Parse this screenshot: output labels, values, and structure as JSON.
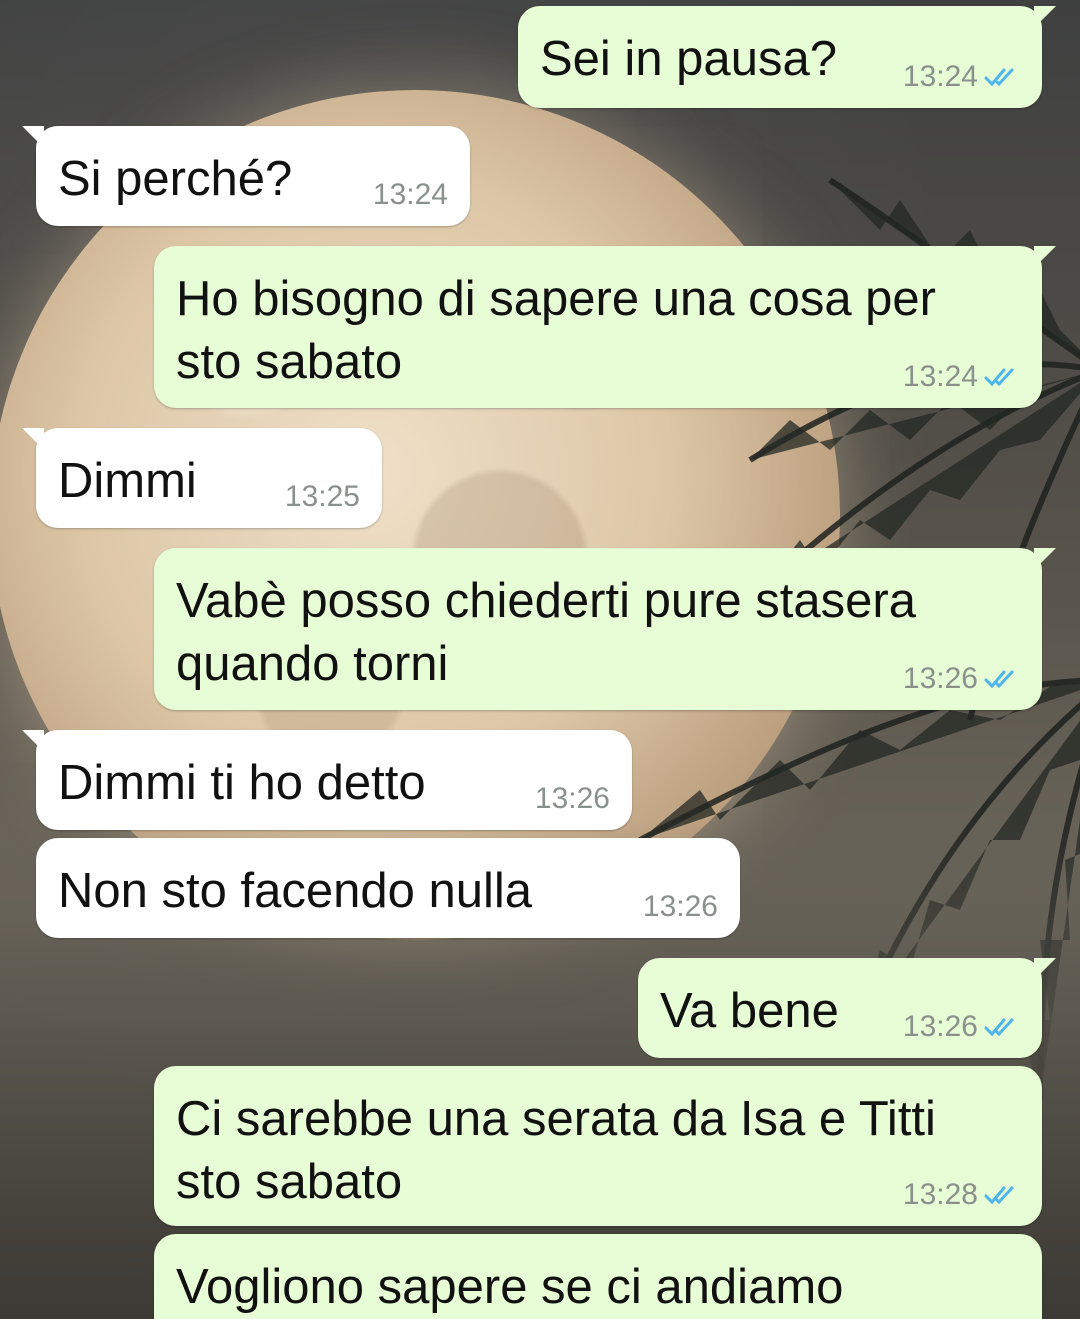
{
  "conversation": {
    "messages": [
      {
        "direction": "out",
        "text": "Sei in pausa?",
        "time": "13:24",
        "status": "read"
      },
      {
        "direction": "in",
        "text": "Si perché?",
        "time": "13:24"
      },
      {
        "direction": "out",
        "text": "Ho bisogno di sapere una cosa per sto sabato",
        "time": "13:24",
        "status": "read"
      },
      {
        "direction": "in",
        "text": "Dimmi",
        "time": "13:25"
      },
      {
        "direction": "out",
        "text": "Vabè posso chiederti pure stasera quando torni",
        "time": "13:26",
        "status": "read"
      },
      {
        "direction": "in",
        "text": "Dimmi ti ho detto",
        "time": "13:26"
      },
      {
        "direction": "in",
        "text": "Non sto facendo nulla",
        "time": "13:26"
      },
      {
        "direction": "out",
        "text": "Va bene",
        "time": "13:26",
        "status": "read"
      },
      {
        "direction": "out",
        "text": "Ci sarebbe una serata da Isa e Titti sto sabato",
        "time": "13:28",
        "status": "read"
      },
      {
        "direction": "out",
        "text": "Vogliono sapere se ci andiamo",
        "time": ""
      }
    ]
  },
  "colors": {
    "outgoing_bubble": "#e7fdd6",
    "incoming_bubble": "#ffffff",
    "read_ticks": "#4fb6ec",
    "timestamp": "#8a918d"
  },
  "icons": {
    "read_receipt": "double-check-icon"
  }
}
